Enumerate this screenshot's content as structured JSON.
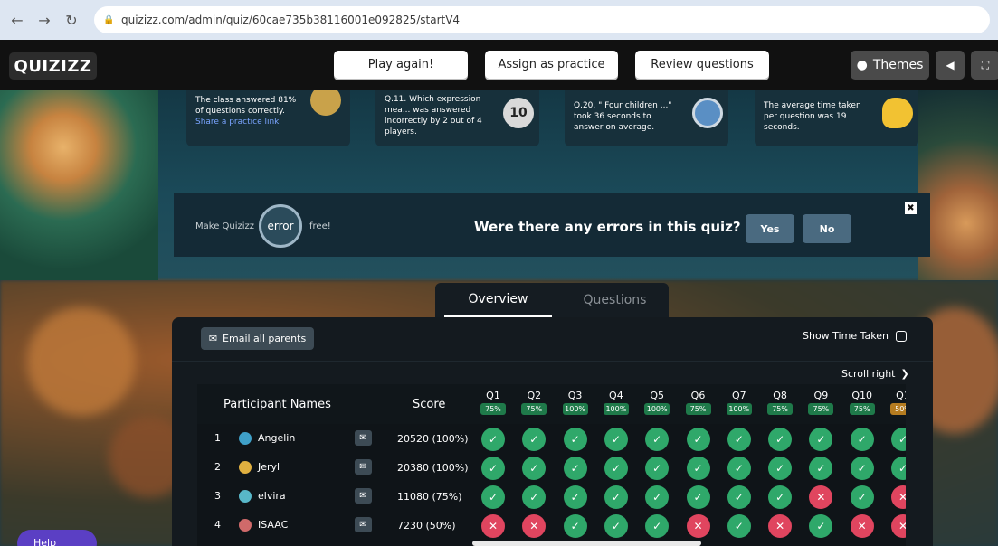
{
  "browser": {
    "back": "←",
    "forward": "→",
    "reload": "↻",
    "url": "quizizz.com/admin/quiz/60cae735b38116001e092825/startV4"
  },
  "header": {
    "logo": "QUIZIZZ",
    "play_again": "Play again!",
    "assign_practice": "Assign as practice",
    "review_questions": "Review questions",
    "themes": "Themes"
  },
  "cards": [
    {
      "text": "The class answered 81% of questions correctly.",
      "link": "Share a practice link"
    },
    {
      "text": "Q.11. Which expression mea... was answered incorrectly by 2 out of 4 players.",
      "badge": "10"
    },
    {
      "text": "Q.20. \" Four children ...\" took 36 seconds to answer on average."
    },
    {
      "text": "The average time taken per question was 19 seconds."
    }
  ],
  "errors_banner": {
    "make": "Make Quizizz",
    "lens": "error",
    "free": "free!",
    "question": "Were there any errors in this quiz?",
    "yes": "Yes",
    "no": "No",
    "close": "✖"
  },
  "tabs": {
    "overview": "Overview",
    "questions": "Questions"
  },
  "panel": {
    "email_all": "Email all parents",
    "show_time": "Show Time Taken",
    "scroll_right": "Scroll right"
  },
  "table": {
    "col_name": "Participant Names",
    "col_score": "Score",
    "questions": [
      {
        "label": "Q1",
        "pct": "75%"
      },
      {
        "label": "Q2",
        "pct": "75%"
      },
      {
        "label": "Q3",
        "pct": "100%"
      },
      {
        "label": "Q4",
        "pct": "100%"
      },
      {
        "label": "Q5",
        "pct": "100%"
      },
      {
        "label": "Q6",
        "pct": "75%"
      },
      {
        "label": "Q7",
        "pct": "100%"
      },
      {
        "label": "Q8",
        "pct": "75%"
      },
      {
        "label": "Q9",
        "pct": "75%"
      },
      {
        "label": "Q10",
        "pct": "75%"
      },
      {
        "label": "Q1",
        "pct": "50%"
      }
    ],
    "rows": [
      {
        "rank": "1",
        "name": "Angelin",
        "score": "20520 (100%)",
        "answers": [
          1,
          1,
          1,
          1,
          1,
          1,
          1,
          1,
          1,
          1,
          1
        ]
      },
      {
        "rank": "2",
        "name": "Jeryl",
        "score": "20380 (100%)",
        "answers": [
          1,
          1,
          1,
          1,
          1,
          1,
          1,
          1,
          1,
          1,
          1
        ]
      },
      {
        "rank": "3",
        "name": "elvira",
        "score": "11080 (75%)",
        "answers": [
          1,
          1,
          1,
          1,
          1,
          1,
          1,
          1,
          0,
          1,
          0
        ]
      },
      {
        "rank": "4",
        "name": "ISAAC",
        "score": "7230 (50%)",
        "answers": [
          0,
          0,
          1,
          1,
          1,
          0,
          1,
          0,
          1,
          0,
          0
        ]
      }
    ]
  },
  "help": "Help",
  "colors": {
    "correct": "#2fa86a",
    "incorrect": "#e0455f",
    "panel": "#141a1f"
  }
}
